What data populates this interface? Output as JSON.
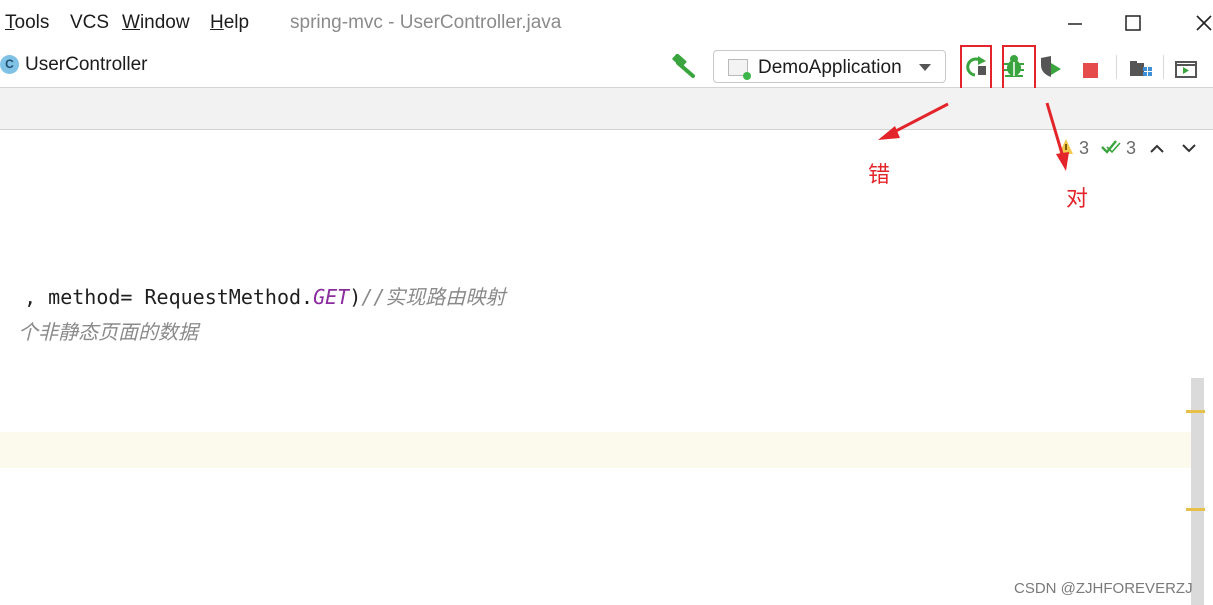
{
  "menu": {
    "tools": "Tools",
    "vcs": "VCS",
    "window": "Window",
    "help": "Help"
  },
  "window_title": "spring-mvc - UserController.java",
  "nav": {
    "class_badge": "C",
    "class_name": "UserController",
    "run_config": "DemoApplication"
  },
  "toolbar_icons": [
    "build-hammer-icon",
    "rerun-icon",
    "debug-icon",
    "run-with-coverage-icon",
    "stop-icon",
    "project-structure-icon",
    "run-panel-icon"
  ],
  "inspections": {
    "warnings": "3",
    "weak_warnings": "3"
  },
  "code": {
    "line1_a": ", method= RequestMethod.",
    "line1_const": "GET",
    "line1_b": ")",
    "line1_comment": "//实现路由映射",
    "line2_comment": "个非静态页面的数据"
  },
  "annotations": {
    "wrong": "错",
    "right": "对"
  },
  "watermark": "CSDN @ZJHFOREVERZJ",
  "colors": {
    "annotation_red": "#e3242b",
    "run_green": "#3cb64a",
    "stop_red": "#e54b4b",
    "constant_purple": "#8a2c9e",
    "comment_gray": "#8a8a8a"
  }
}
